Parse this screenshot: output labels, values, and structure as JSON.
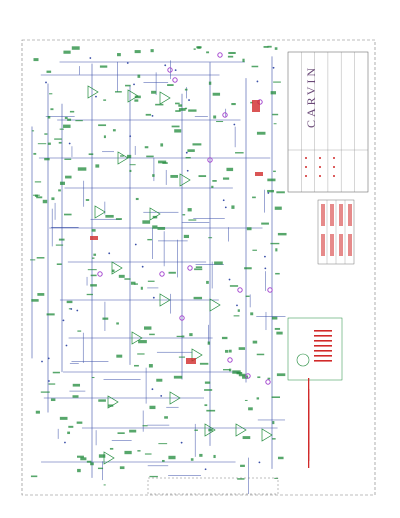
{
  "title_block": {
    "brand": "CARVIN"
  },
  "colors": {
    "wire": "#3a4fa8",
    "component": "#1f8a3a",
    "note": "#d12a2a",
    "border": "#7a7a7a",
    "marker": "#a64ad0"
  }
}
